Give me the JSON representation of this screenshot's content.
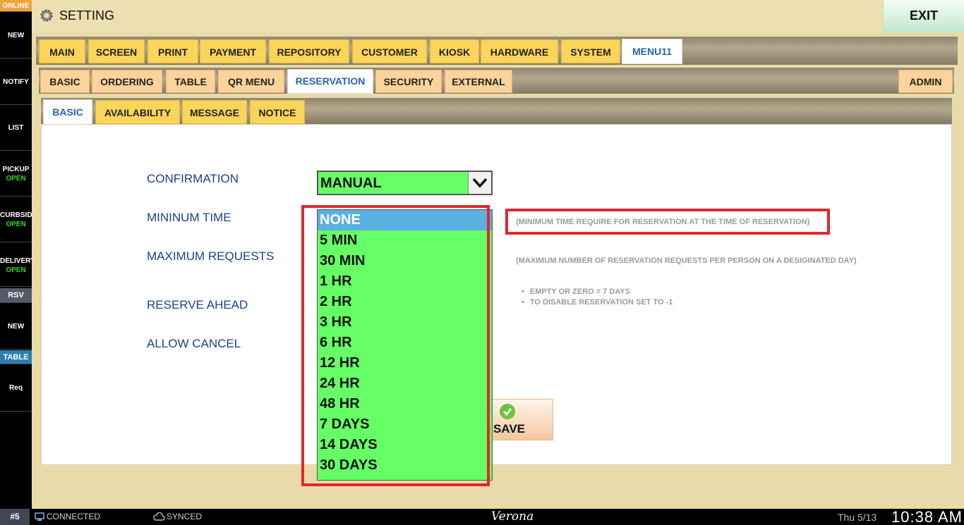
{
  "sidebar": {
    "online": "ONLINE",
    "new": "NEW",
    "notify": "NOTIFY",
    "list": "LIST",
    "pickup": {
      "label": "PICKUP",
      "status": "OPEN"
    },
    "curbside": {
      "label": "CURBSIDE",
      "status": "OPEN"
    },
    "delivery": {
      "label": "DELIVERY",
      "status": "OPEN"
    },
    "rsv": "RSV",
    "new2": "NEW",
    "table": "TABLE",
    "req": "Req"
  },
  "header": {
    "title": "SETTING",
    "exit": "EXIT",
    "icon": "gear-icon"
  },
  "tabs_main": [
    "MAIN",
    "SCREEN",
    "PRINT",
    "PAYMENT",
    "REPOSITORY",
    "CUSTOMER",
    "KIOSK",
    "HARDWARE",
    "SYSTEM",
    "MENU11"
  ],
  "tabs_sub": [
    "BASIC",
    "ORDERING",
    "TABLE",
    "QR MENU",
    "RESERVATION",
    "SECURITY",
    "EXTERNAL"
  ],
  "tab_admin": "ADMIN",
  "tabs_reservation": [
    "BASIC",
    "AVAILABILITY",
    "MESSAGE",
    "NOTICE"
  ],
  "form": {
    "confirmation": {
      "label": "CONFIRMATION",
      "value": "MANUAL"
    },
    "min_time": {
      "label": "MININUM TIME",
      "hint": "(MINIMUM TIME REQUIRE FOR RESERVATION AT THE TIME OF RESERVATION)"
    },
    "max_requests": {
      "label": "MAXIMUM REQUESTS",
      "hint": "(MAXIMUM NUMBER OF RESERVATION REQUESTS PER PERSON ON A DESIGINATED DAY)"
    },
    "reserve_ahead": {
      "label": "RESERVE AHEAD",
      "hints": [
        "EMPTY OR ZERO = 7 DAYS",
        "TO DISABLE RESERVATION SET TO -1"
      ]
    },
    "allow_cancel": {
      "label": "ALLOW CANCEL"
    }
  },
  "dropdown_options": [
    "NONE",
    "5 MIN",
    "30 MIN",
    "1 HR",
    "2 HR",
    "3 HR",
    "6 HR",
    "12 HR",
    "24 HR",
    "48 HR",
    "7 DAYS",
    "14 DAYS",
    "30 DAYS"
  ],
  "dropdown_selected": "NONE",
  "save_button": {
    "label": "SAVE"
  },
  "footer": {
    "station": "#5",
    "connected": "CONNECTED",
    "synced": "SYNCED",
    "store": "Verona",
    "date": "Thu 5/13",
    "time": "10:38 AM"
  },
  "colors": {
    "select_bg": "#66ff66",
    "selected_option": "#5ab0e0",
    "annotation": "#e3262d",
    "tab_yellow": "#fbd45a",
    "tab_orange": "#fcd39a"
  }
}
